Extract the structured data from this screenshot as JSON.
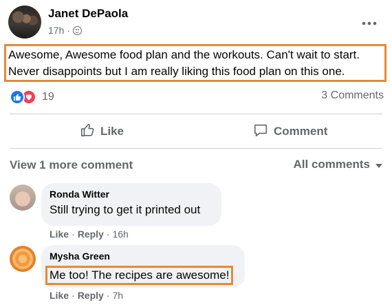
{
  "post": {
    "author": "Janet DePaola",
    "time": "17h",
    "separator": "·",
    "text_line1": "Awesome, Awesome food plan and the workouts.  Can't wait to start.",
    "text_line2": "Never disappoints but I am really liking this food plan on this one.",
    "reaction_count": "19",
    "comments_count": "3 Comments",
    "like_label": "Like",
    "comment_label": "Comment"
  },
  "comments_section": {
    "view_more": "View 1 more comment",
    "filter": "All comments"
  },
  "comments": [
    {
      "name": "Ronda Witter",
      "text": "Still trying to get it printed out",
      "like": "Like",
      "reply": "Reply",
      "time": "16h"
    },
    {
      "name": "Mysha Green",
      "text": "Me too! The recipes are awesome!",
      "like": "Like",
      "reply": "Reply",
      "time": "7h"
    }
  ],
  "colors": {
    "highlight": "#e58a35",
    "like_blue": "#1877f2",
    "love_red": "#f33e58",
    "secondary_text": "#65676b",
    "bubble_bg": "#f0f2f5"
  },
  "icons": [
    "more-icon",
    "globe-icon",
    "like-reaction-icon",
    "love-reaction-icon",
    "thumbs-up-icon",
    "comment-icon",
    "caret-down-icon"
  ]
}
